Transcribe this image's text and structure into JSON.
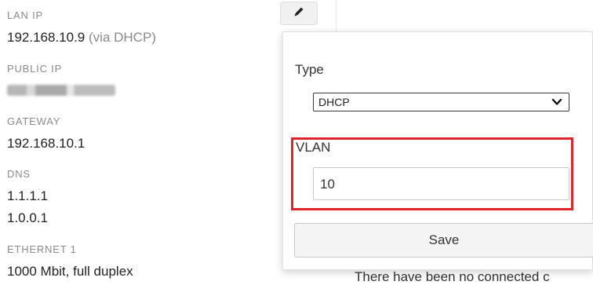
{
  "details": {
    "lan_ip": {
      "label": "LAN IP",
      "value": "192.168.10.9",
      "suffix": "(via DHCP)"
    },
    "public_ip": {
      "label": "PUBLIC IP"
    },
    "gateway": {
      "label": "GATEWAY",
      "value": "192.168.10.1"
    },
    "dns": {
      "label": "DNS",
      "values": [
        "1.1.1.1",
        "1.0.0.1"
      ]
    },
    "ethernet": {
      "label": "ETHERNET 1",
      "value": "1000 Mbit, full duplex"
    }
  },
  "edit_button": {
    "icon": "pencil-icon"
  },
  "popover": {
    "type_label": "Type",
    "type_selected": "DHCP",
    "vlan_label": "VLAN",
    "vlan_value": "10",
    "save_label": "Save",
    "highlight_color": "#e0242b"
  },
  "background_text": "There have been no connected c"
}
